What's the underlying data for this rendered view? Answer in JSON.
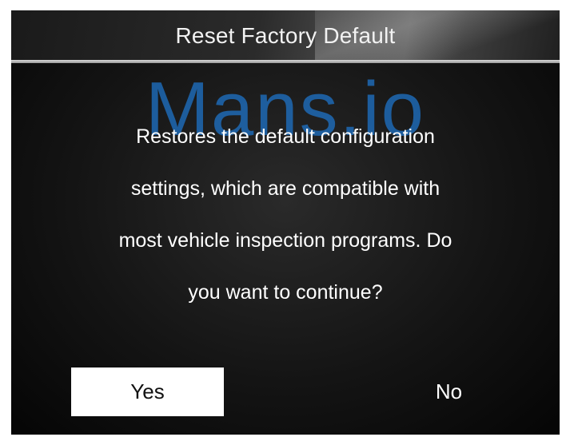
{
  "dialog": {
    "title": "Reset Factory Default",
    "message_lines": [
      "Restores the default configuration",
      "settings, which are compatible with",
      "most vehicle inspection programs. Do",
      "you want to continue?"
    ],
    "yes_label": "Yes",
    "no_label": "No",
    "selected_option": "Yes"
  },
  "watermark": {
    "text": "Mans.io"
  }
}
